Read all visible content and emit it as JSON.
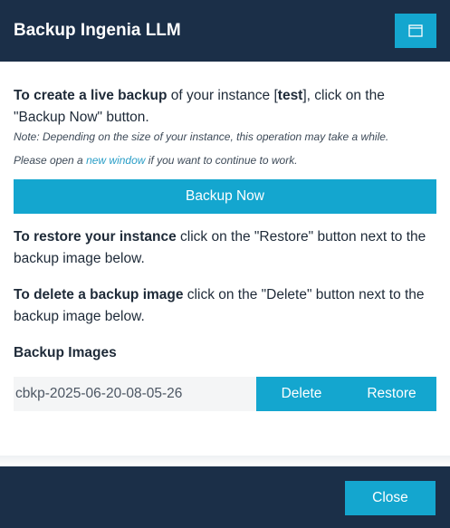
{
  "dialog": {
    "title": "Backup Ingenia LLM",
    "maximize_icon": "window-maximize-icon"
  },
  "live_backup": {
    "lead_bold": "To create a live backup",
    "text_a": " of your instance [",
    "instance": "test",
    "text_b": "], click on the \"Backup Now\" button.",
    "note1": "Note: Depending on the size of your instance, this operation may take a while.",
    "note2_a": "Please open a ",
    "note2_link": "new window",
    "note2_b": " if you want to continue to work."
  },
  "backup_now_label": "Backup Now",
  "restore": {
    "lead_bold": "To restore your instance",
    "text": " click on the \"Restore\" button next to the backup image below."
  },
  "delete": {
    "lead_bold": "To delete a backup image",
    "text": " click on the \"Delete\" button next to the backup image below."
  },
  "backup_images": {
    "title": "Backup Images",
    "items": [
      {
        "name": "cbkp-2025-06-20-08-05-26",
        "delete_label": "Delete",
        "restore_label": "Restore"
      }
    ]
  },
  "footer": {
    "close_label": "Close"
  },
  "colors": {
    "header_bg": "#1b2f48",
    "accent": "#14a6cf",
    "link": "#2a9ec7"
  }
}
